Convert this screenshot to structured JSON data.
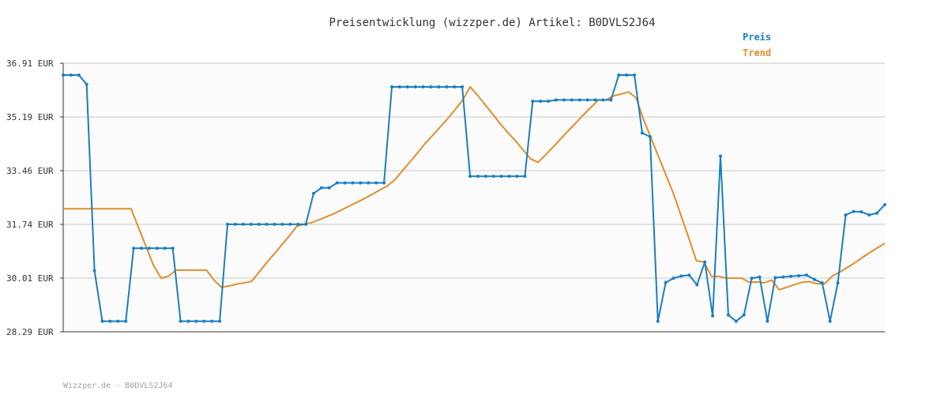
{
  "chart_data": {
    "type": "line",
    "title": "Preisentwicklung (wizzper.de) Artikel: B0DVLS2J64",
    "footer": "Wizzper.de - B0DVLS2J64",
    "ylim": [
      28.29,
      36.91
    ],
    "grid": true,
    "legend_position": "top-right",
    "y_ticks": [
      "36.91 EUR",
      "35.19 EUR",
      "33.46 EUR",
      "31.74 EUR",
      "30.01 EUR",
      "28.29 EUR"
    ],
    "series": [
      {
        "name": "Preis",
        "color": "#1a7fc1",
        "values": [
          36.53,
          36.53,
          36.53,
          36.23,
          30.25,
          28.63,
          28.63,
          28.63,
          28.63,
          30.97,
          30.97,
          30.97,
          30.97,
          30.97,
          30.97,
          28.63,
          28.63,
          28.63,
          28.63,
          28.63,
          28.63,
          31.74,
          31.74,
          31.74,
          31.74,
          31.74,
          31.74,
          31.74,
          31.74,
          31.74,
          31.74,
          31.74,
          32.73,
          32.91,
          32.91,
          33.07,
          33.07,
          33.07,
          33.07,
          33.07,
          33.07,
          33.07,
          36.15,
          36.15,
          36.15,
          36.15,
          36.15,
          36.15,
          36.15,
          36.15,
          36.15,
          36.15,
          33.28,
          33.28,
          33.28,
          33.28,
          33.28,
          33.28,
          33.28,
          33.28,
          35.69,
          35.69,
          35.69,
          35.73,
          35.73,
          35.73,
          35.73,
          35.73,
          35.73,
          35.73,
          35.73,
          36.53,
          36.53,
          36.53,
          34.67,
          34.55,
          28.63,
          29.87,
          30.01,
          30.08,
          30.11,
          29.8,
          30.53,
          28.8,
          33.93,
          28.83,
          28.63,
          28.83,
          30.01,
          30.05,
          28.63,
          30.03,
          30.05,
          30.07,
          30.09,
          30.11,
          29.97,
          29.86,
          28.63,
          29.86,
          32.04,
          32.15,
          32.14,
          32.04,
          32.1,
          32.37
        ]
      },
      {
        "name": "Trend",
        "color": "#e08e2a",
        "values": [
          32.24,
          32.24,
          32.24,
          32.24,
          32.24,
          32.24,
          32.24,
          32.24,
          32.24,
          32.24,
          31.63,
          31.02,
          30.41,
          30.01,
          30.08,
          30.27,
          30.27,
          30.27,
          30.27,
          30.27,
          29.95,
          29.72,
          29.76,
          29.82,
          29.86,
          29.91,
          30.21,
          30.51,
          30.79,
          31.08,
          31.37,
          31.68,
          31.74,
          31.8,
          31.89,
          31.99,
          32.09,
          32.21,
          32.33,
          32.45,
          32.57,
          32.7,
          32.84,
          32.97,
          33.17,
          33.46,
          33.74,
          34.03,
          34.33,
          34.59,
          34.86,
          35.13,
          35.42,
          35.73,
          36.15,
          35.87,
          35.57,
          35.27,
          34.96,
          34.68,
          34.42,
          34.13,
          33.84,
          33.73,
          33.97,
          34.22,
          34.48,
          34.74,
          34.99,
          35.25,
          35.49,
          35.73,
          35.73,
          35.86,
          35.92,
          35.99,
          35.8,
          35.1,
          34.5,
          33.9,
          33.3,
          32.7,
          32.0,
          31.3,
          30.57,
          30.53,
          30.07,
          30.07,
          30.01,
          30.01,
          30.01,
          29.88,
          29.89,
          29.86,
          29.95,
          29.64,
          29.72,
          29.8,
          29.88,
          29.9,
          29.83,
          29.83,
          30.07,
          30.2,
          30.35,
          30.5,
          30.67,
          30.83,
          30.98,
          31.13
        ]
      }
    ]
  }
}
